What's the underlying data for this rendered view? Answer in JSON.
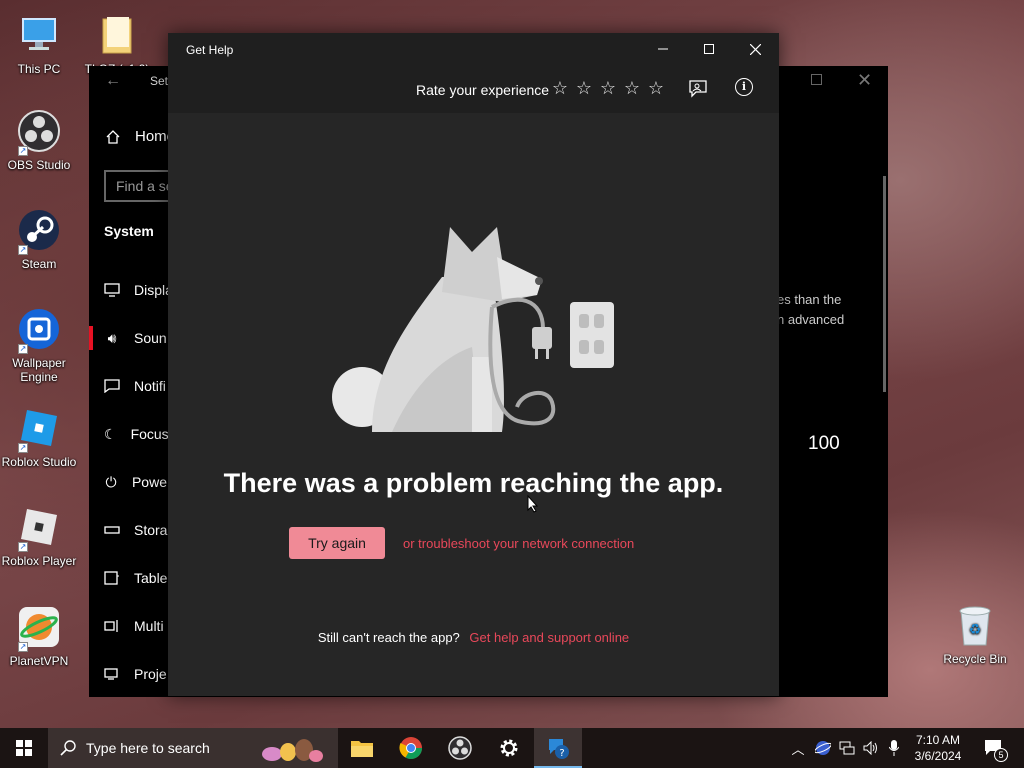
{
  "desktop": {
    "icons": [
      {
        "label": "This PC",
        "name": "this-pc"
      },
      {
        "label": "TLOZ (v1.2)",
        "name": "folder"
      },
      {
        "label": "OBS Studio",
        "name": "obs-studio"
      },
      {
        "label": "Steam",
        "name": "steam"
      },
      {
        "label": "Wallpaper Engine",
        "name": "wallpaper-engine"
      },
      {
        "label": "Roblox Studio",
        "name": "roblox-studio"
      },
      {
        "label": "Roblox Player",
        "name": "roblox-player"
      },
      {
        "label": "PlanetVPN",
        "name": "planetvpn"
      },
      {
        "label": "Recycle Bin",
        "name": "recycle-bin"
      }
    ]
  },
  "settings": {
    "title": "Set",
    "home": "Home",
    "search_placeholder": "Find a se",
    "section": "System",
    "nav": [
      {
        "label": "Displa",
        "icon": "display-icon"
      },
      {
        "label": "Soun",
        "icon": "sound-icon",
        "active": true
      },
      {
        "label": "Notifi",
        "icon": "notifications-icon"
      },
      {
        "label": "Focus",
        "icon": "focus-assist-icon"
      },
      {
        "label": "Powe",
        "icon": "power-icon"
      },
      {
        "label": "Stora",
        "icon": "storage-icon"
      },
      {
        "label": "Table",
        "icon": "tablet-icon"
      },
      {
        "label": "Multi",
        "icon": "multitasking-icon"
      },
      {
        "label": "Proje",
        "icon": "projecting-icon"
      }
    ],
    "right_text": "es than the\nn advanced",
    "volume_value": "100"
  },
  "gethelp": {
    "title": "Get Help",
    "rate_label": "Rate your experience",
    "stars": [
      "☆",
      "☆",
      "☆",
      "☆",
      "☆"
    ],
    "heading": "There was a problem reaching the app.",
    "retry_label": "Try again",
    "troubleshoot_link": "or troubleshoot your network connection",
    "still_question": "Still can't reach the app?",
    "support_link": "Get help and support online",
    "accent": "#e8485a"
  },
  "taskbar": {
    "search_placeholder": "Type here to search",
    "time": "7:10 AM",
    "date": "3/6/2024",
    "notification_count": "5"
  }
}
